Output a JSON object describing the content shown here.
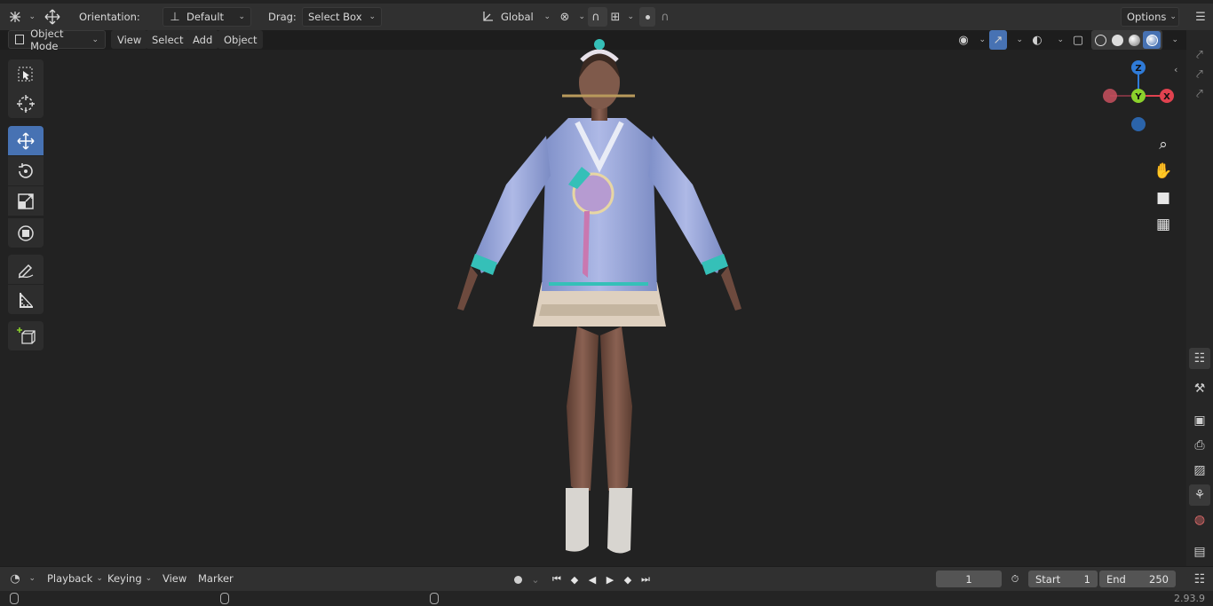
{
  "header": {
    "orientation_label": "Orientation:",
    "orientation_value": "Default",
    "drag_label": "Drag:",
    "drag_value": "Select Box",
    "transform_space": "Global",
    "options_label": "Options"
  },
  "view_menu": {
    "mode": "Object Mode",
    "items": [
      "View",
      "Select",
      "Add",
      "Object"
    ]
  },
  "gizmo": {
    "z": "Z",
    "y": "Y",
    "x": "X"
  },
  "timeline": {
    "menus": [
      "Playback",
      "Keying",
      "View",
      "Marker"
    ],
    "current_frame": "1",
    "start_label": "Start",
    "start_value": "1",
    "end_label": "End",
    "end_value": "250"
  },
  "status": {
    "version": "2.93.9"
  },
  "colors": {
    "accent": "#4772b3",
    "axis_x": "#e0424f",
    "axis_y": "#8bd12c",
    "axis_z": "#2f7bd8"
  }
}
